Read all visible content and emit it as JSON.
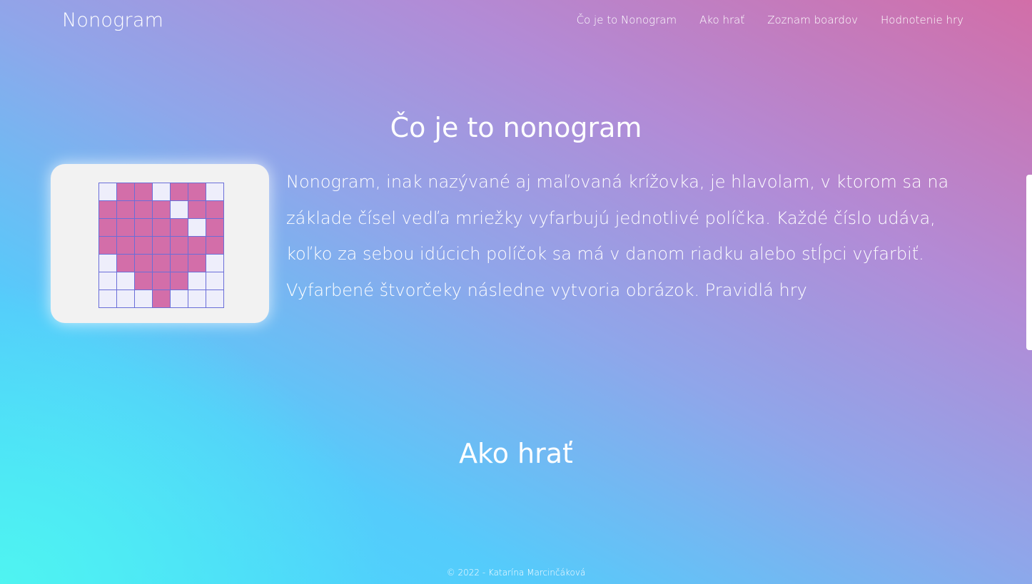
{
  "navbar": {
    "brand": "Nonogram",
    "links": [
      "Čo je to Nonogram",
      "Ako hrať",
      "Zoznam boardov",
      "Hodnotenie hry"
    ]
  },
  "sections": {
    "intro_title": "Čo je to nonogram",
    "intro_text": "Nonogram, inak nazývané aj maľovaná krížovka, je hlavolam, v ktorom sa na základe čísel vedľa mriežky vyfarbujú jednotlivé políčka. Každé číslo udáva, koľko za sebou idúcich políčok sa má v danom riadku alebo stĺpci vyfarbiť. Vyfarbené štvorčeky následne vytvoria obrázok. Pravidlá hry",
    "howto_title": "Ako hrať"
  },
  "nonogram_image": {
    "filled_color": "#d36ea9",
    "empty_color": "#eeeefb",
    "grid_line_color": "#6a6ed8",
    "grid": [
      [
        0,
        1,
        1,
        0,
        1,
        1,
        0
      ],
      [
        1,
        1,
        1,
        1,
        0,
        1,
        1
      ],
      [
        1,
        1,
        1,
        1,
        1,
        0,
        1
      ],
      [
        1,
        1,
        1,
        1,
        1,
        1,
        1
      ],
      [
        0,
        1,
        1,
        1,
        1,
        1,
        0
      ],
      [
        0,
        0,
        1,
        1,
        1,
        0,
        0
      ],
      [
        0,
        0,
        0,
        1,
        0,
        0,
        0
      ]
    ]
  },
  "footer": {
    "text": "© 2022 - Katarína Marcinčáková"
  }
}
